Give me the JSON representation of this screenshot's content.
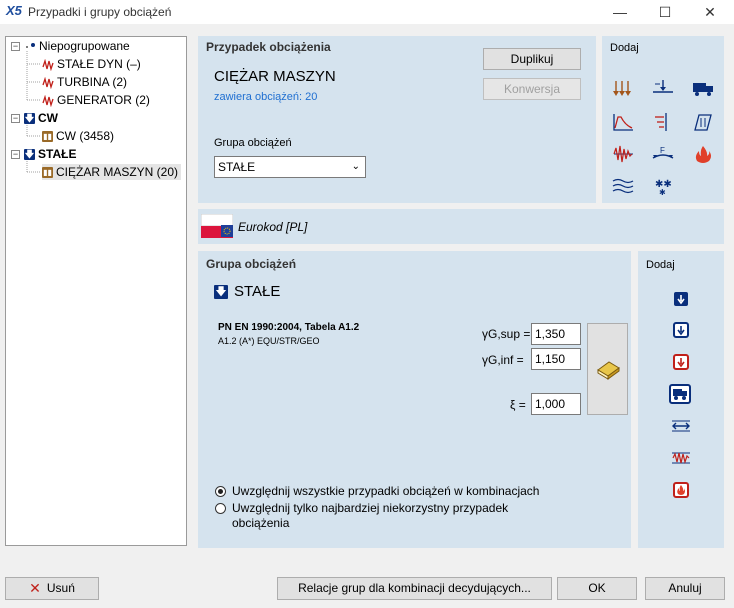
{
  "window": {
    "title": "Przypadki i grupy obciążeń",
    "logo": "X5"
  },
  "tree": {
    "items": [
      {
        "label": "Niepogrupowane",
        "icon": "ungrouped-icon",
        "level": 0
      },
      {
        "label": "STAŁE DYN (–)",
        "icon": "dynamic-load-icon",
        "level": 1
      },
      {
        "label": "TURBINA (2)",
        "icon": "dynamic-load-icon",
        "level": 1
      },
      {
        "label": "GENERATOR (2)",
        "icon": "dynamic-load-icon",
        "level": 1
      },
      {
        "label": "CW",
        "icon": "permanent-group-icon",
        "level": 0
      },
      {
        "label": "CW (3458)",
        "icon": "load-case-icon",
        "level": 1
      },
      {
        "label": "STAŁE",
        "icon": "permanent-group-icon",
        "level": 0
      },
      {
        "label": "CIĘŻAR MASZYN (20)",
        "icon": "load-case-icon",
        "level": 1,
        "selected": true
      }
    ]
  },
  "load_case": {
    "header": "Przypadek obciążenia",
    "name": "CIĘŻAR MASZYN",
    "count_text": "zawiera obciążeń: 20",
    "duplicate_label": "Duplikuj",
    "convert_label": "Konwersja",
    "group_label": "Grupa obciążeń",
    "group_value": "STAŁE"
  },
  "add_top": {
    "label": "Dodaj",
    "icons": [
      "distributed-load-icon",
      "nodal-load-icon",
      "vehicle-load-icon",
      "response-spectrum-icon",
      "wind-load-icon",
      "snow-load-icon",
      "seismic-load-icon",
      "temperature-load-icon",
      "fire-icon",
      "wind-profile-icon",
      "snowflake-icon"
    ]
  },
  "code": {
    "label": "Eurokod [PL]"
  },
  "group": {
    "header": "Grupa obciążeń",
    "name": "STAŁE",
    "standard": "PN EN 1990:2004, Tabela A1.2",
    "standard_sub": "A1.2 (A*) EQU/STR/GEO",
    "gamma_sup_label": "γG,sup =",
    "gamma_sup_value": "1,350",
    "gamma_inf_label": "γG,inf =",
    "gamma_inf_value": "1,150",
    "xi_label": "ξ =",
    "xi_value": "1,000",
    "radio_all": "Uwzględnij wszystkie przypadki obciążeń w kombinacjach",
    "radio_worst_1": "Uwzględnij tylko najbardziej niekorzystny przypadek",
    "radio_worst_2": "obciążenia"
  },
  "add_side": {
    "label": "Dodaj",
    "icons": [
      "permanent-group-icon",
      "variable-group-icon",
      "accidental-group-icon",
      "moving-load-group-icon",
      "prestress-group-icon",
      "seismic-group-icon",
      "fire-group-icon"
    ]
  },
  "footer": {
    "delete_label": "Usuń",
    "relations_label": "Relacje grup dla kombinacji decydujących...",
    "ok_label": "OK",
    "cancel_label": "Anuluj"
  },
  "colors": {
    "accent": "#1f6fd1",
    "panel": "#d5e3ee",
    "icon_blue": "#0a2f7c",
    "icon_red": "#c0201a"
  }
}
